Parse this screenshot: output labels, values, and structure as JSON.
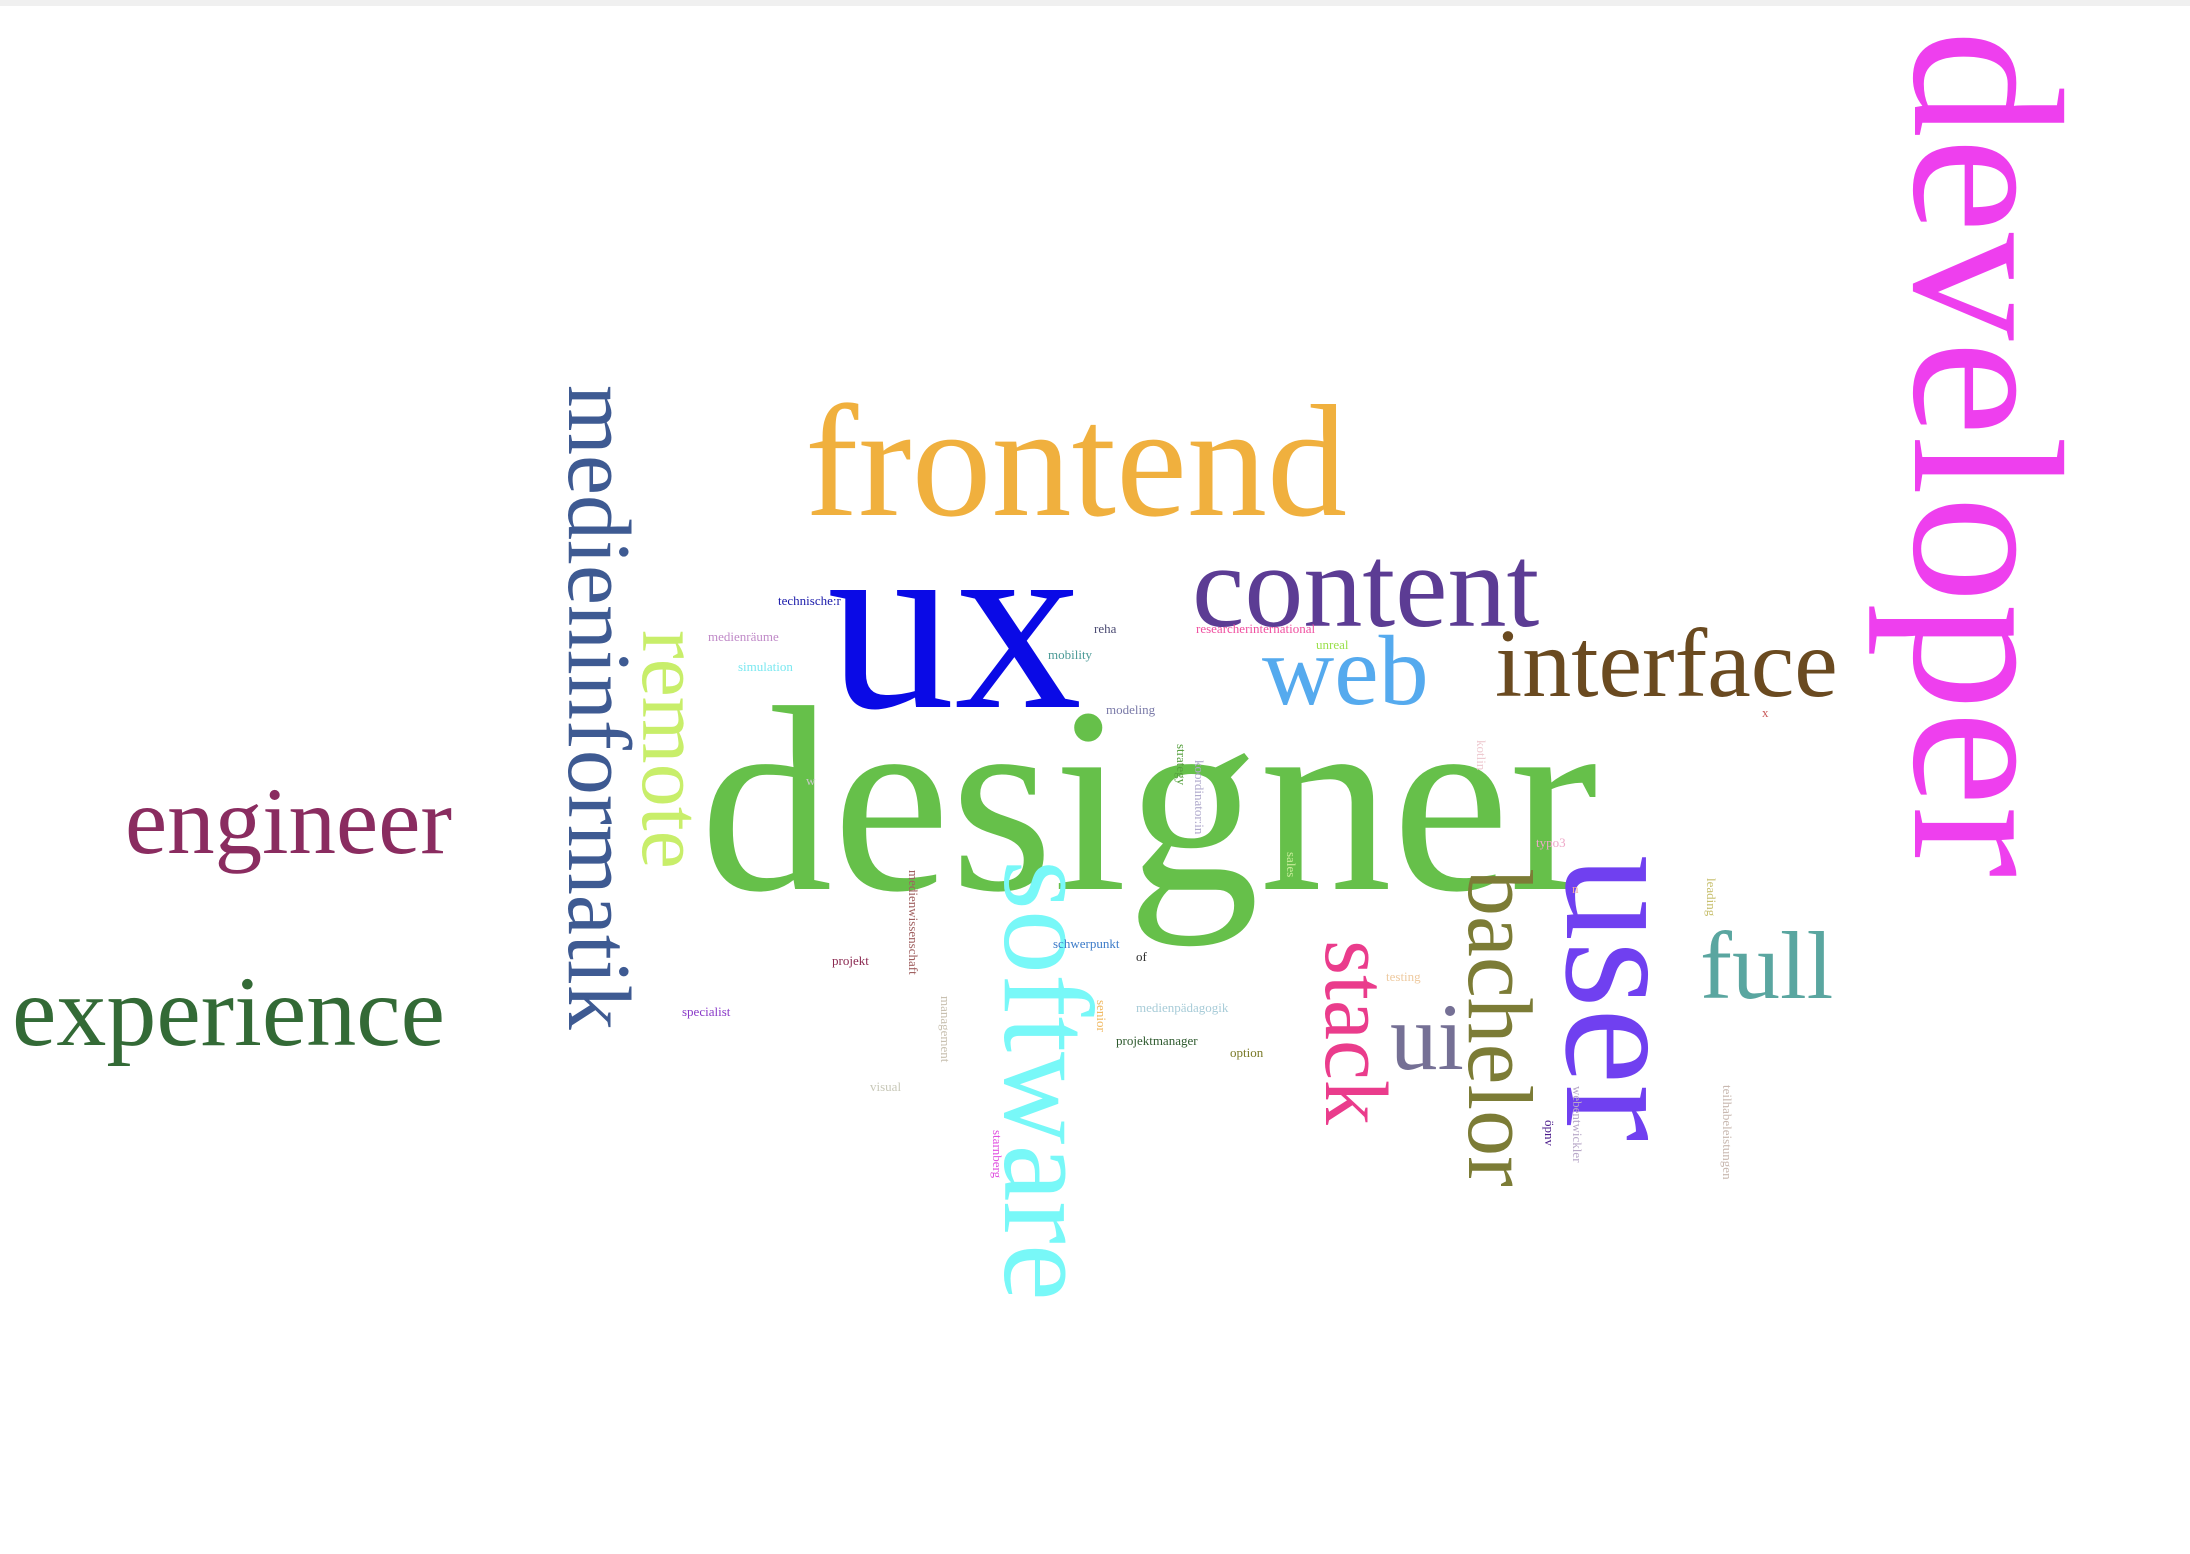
{
  "words": {
    "developer": {
      "text": "developer",
      "color": "#ee3fee"
    },
    "designer": {
      "text": "designer",
      "color": "#66c04a"
    },
    "ux": {
      "text": "ux",
      "color": "#0a0ae6"
    },
    "frontend": {
      "text": "frontend",
      "color": "#f0b03e"
    },
    "content": {
      "text": "content",
      "color": "#5c3c94"
    },
    "web": {
      "text": "web",
      "color": "#55aaee"
    },
    "interface": {
      "text": "interface",
      "color": "#6a4a20"
    },
    "user": {
      "text": "user",
      "color": "#7040f0"
    },
    "bachelor": {
      "text": "bachelor",
      "color": "#7c7c36"
    },
    "full": {
      "text": "full",
      "color": "#5aa6a0"
    },
    "ui": {
      "text": "ui",
      "color": "#757095"
    },
    "stack": {
      "text": "stack",
      "color": "#ea3c8c"
    },
    "software": {
      "text": "software",
      "color": "#78f8f8"
    },
    "remote": {
      "text": "remote",
      "color": "#c8ee6a"
    },
    "medieninformatik": {
      "text": "medieninformatik",
      "color": "#3e5a92"
    },
    "engineer": {
      "text": "engineer",
      "color": "#8a2c60"
    },
    "experience": {
      "text": "experience",
      "color": "#336a36"
    },
    "technischer": {
      "text": "technische:r",
      "color": "#1a1aaa"
    },
    "medienraeume": {
      "text": "medienräume",
      "color": "#c08ac8"
    },
    "simulation": {
      "text": "simulation",
      "color": "#7ae8f0"
    },
    "reha": {
      "text": "reha",
      "color": "#4a4a72"
    },
    "researcherinternational": {
      "text": "researcherinternational",
      "color": "#f050a0"
    },
    "unreal": {
      "text": "unreal",
      "color": "#9ae04a"
    },
    "mobility": {
      "text": "mobility",
      "color": "#4a9a96"
    },
    "modeling": {
      "text": "modeling",
      "color": "#7a7aa8"
    },
    "strategy": {
      "text": "strategy",
      "color": "#56a03e"
    },
    "koordinatorin": {
      "text": "koordinator:in",
      "color": "#b0aacc"
    },
    "kotlin": {
      "text": "kotlin",
      "color": "#eecad0"
    },
    "x": {
      "text": "x",
      "color": "#c85858"
    },
    "w": {
      "text": "w",
      "color": "#c8c8c8"
    },
    "typo3": {
      "text": "typo3",
      "color": "#eea8c8"
    },
    "sales": {
      "text": "sales",
      "color": "#c8ee9a"
    },
    "medienwissenschaft": {
      "text": "medienwissenschaft",
      "color": "#a06060"
    },
    "projekt": {
      "text": "projekt",
      "color": "#8a2850"
    },
    "schwerpunkt": {
      "text": "schwerpunkt",
      "color": "#3a7ac8"
    },
    "of": {
      "text": "of",
      "color": "#303030"
    },
    "testing": {
      "text": "testing",
      "color": "#eecaa0"
    },
    "leading": {
      "text": "leading",
      "color": "#c8c070"
    },
    "n": {
      "text": "n",
      "color": "#f0a8a0"
    },
    "specialist": {
      "text": "specialist",
      "color": "#8a3ac8"
    },
    "management": {
      "text": "management",
      "color": "#c8c0b0"
    },
    "senior": {
      "text": "senior",
      "color": "#f0b860"
    },
    "medienpaedagogik": {
      "text": "medienpädagogik",
      "color": "#a8ccd8"
    },
    "projektmanager": {
      "text": "projektmanager",
      "color": "#2e5a2e"
    },
    "option": {
      "text": "option",
      "color": "#7a7a28"
    },
    "visual": {
      "text": "visual",
      "color": "#c8c8b8"
    },
    "starnberg": {
      "text": "starnberg",
      "color": "#e050e0"
    },
    "oepnv": {
      "text": "öpnv",
      "color": "#4a1a8a"
    },
    "webentwickler": {
      "text": "webentwickler",
      "color": "#b8a8c8"
    },
    "teilhabeleistungen": {
      "text": "teilhabeleistungen",
      "color": "#c8b8b0"
    }
  }
}
